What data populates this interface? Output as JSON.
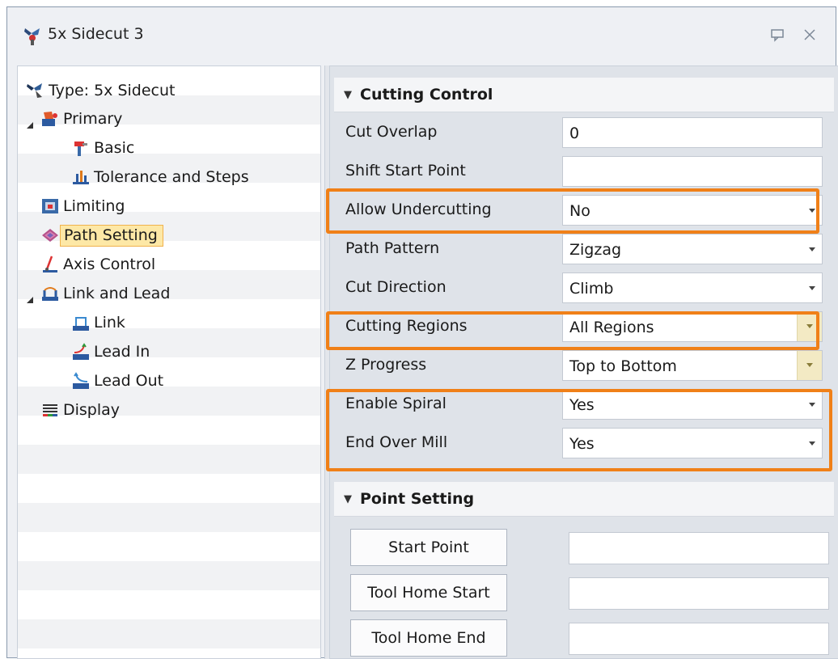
{
  "window": {
    "title": "5x Sidecut 3",
    "icons": {
      "app": "operation-icon",
      "restore": "restore-icon",
      "close": "close-icon"
    }
  },
  "tree": {
    "items": [
      {
        "label": "Type: 5x Sidecut",
        "icon": "sidecut-type-icon"
      },
      {
        "label": "Primary",
        "icon": "primary-icon",
        "expanded": true
      },
      {
        "label": "Basic",
        "icon": "tool-basic-icon"
      },
      {
        "label": "Tolerance and Steps",
        "icon": "tolerance-icon"
      },
      {
        "label": "Limiting",
        "icon": "limiting-icon"
      },
      {
        "label": "Path Setting",
        "icon": "path-setting-icon",
        "selected": true
      },
      {
        "label": "Axis Control",
        "icon": "axis-control-icon"
      },
      {
        "label": "Link and Lead",
        "icon": "link-lead-icon",
        "expanded": true
      },
      {
        "label": "Link",
        "icon": "link-icon"
      },
      {
        "label": "Lead In",
        "icon": "lead-in-icon"
      },
      {
        "label": "Lead Out",
        "icon": "lead-out-icon"
      },
      {
        "label": "Display",
        "icon": "display-icon"
      }
    ]
  },
  "cutting_control": {
    "title": "Cutting Control",
    "rows": [
      {
        "label": "Cut Overlap",
        "value": "0",
        "dropdown": false
      },
      {
        "label": "Shift Start Point",
        "value": "",
        "dropdown": false
      },
      {
        "label": "Allow Undercutting",
        "value": "No",
        "dropdown": true
      },
      {
        "label": "Path Pattern",
        "value": "Zigzag",
        "dropdown": true
      },
      {
        "label": "Cut Direction",
        "value": "Climb",
        "dropdown": true
      },
      {
        "label": "Cutting Regions",
        "value": "All Regions",
        "dropdown": true
      },
      {
        "label": "Z Progress",
        "value": "Top to Bottom",
        "dropdown": true
      },
      {
        "label": "Enable Spiral",
        "value": "Yes",
        "dropdown": true
      },
      {
        "label": "End Over Mill",
        "value": "Yes",
        "dropdown": true
      }
    ]
  },
  "point_setting": {
    "title": "Point Setting",
    "rows": [
      {
        "button": "Start Point",
        "value": ""
      },
      {
        "button": "Tool Home Start",
        "value": ""
      },
      {
        "button": "Tool Home End",
        "value": ""
      }
    ]
  },
  "colors": {
    "highlight": "#f08018",
    "selection_fill": "#fde8a6",
    "selection_border": "#f0b24d"
  }
}
